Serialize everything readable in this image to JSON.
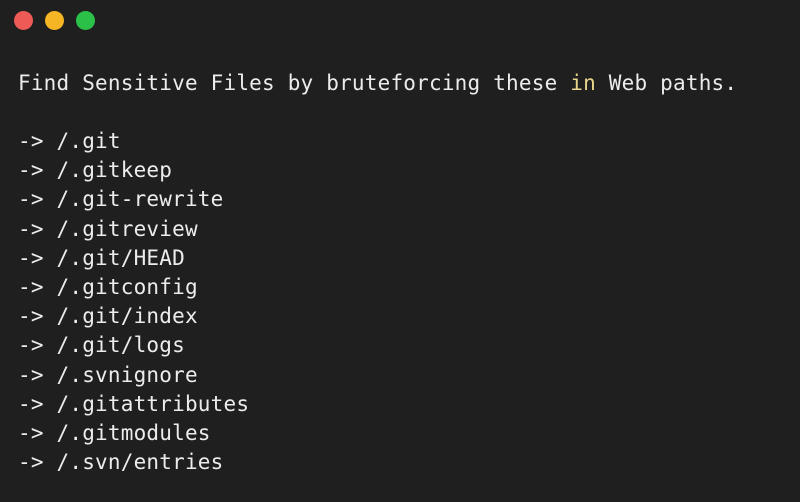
{
  "window": {
    "controls": {
      "close_color": "#ee5b57",
      "minimize_color": "#f5b524",
      "maximize_color": "#2bc148"
    }
  },
  "heading": {
    "before": "Find Sensitive Files by bruteforcing these ",
    "keyword": "in",
    "after": " Web paths.",
    "keyword_color": "#e8d48a"
  },
  "arrow": "->",
  "paths": [
    "/.git",
    "/.gitkeep",
    "/.git-rewrite",
    "/.gitreview",
    "/.git/HEAD",
    "/.gitconfig",
    "/.git/index",
    "/.git/logs",
    "/.svnignore",
    "/.gitattributes",
    "/.gitmodules",
    "/.svn/entries"
  ]
}
